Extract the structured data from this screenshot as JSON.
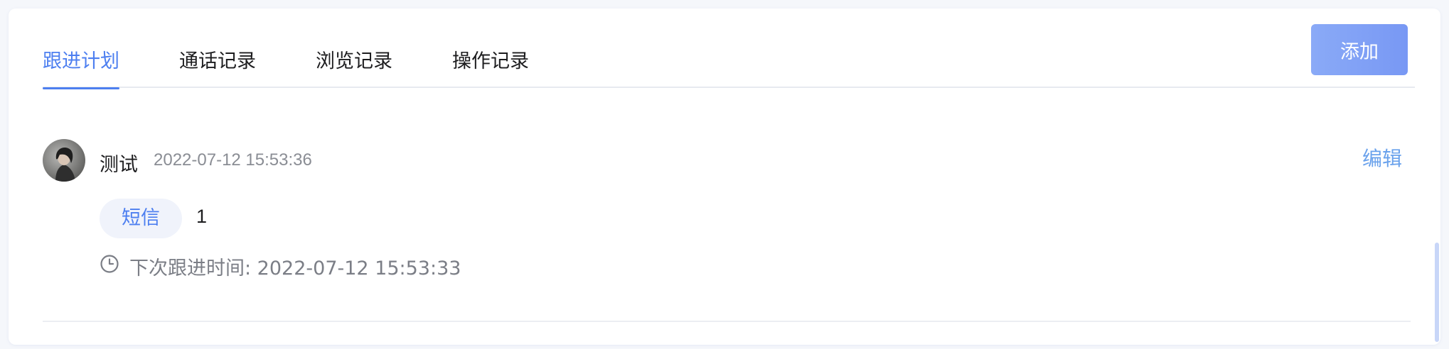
{
  "tabs": [
    {
      "label": "跟进计划",
      "active": true
    },
    {
      "label": "通话记录",
      "active": false
    },
    {
      "label": "浏览记录",
      "active": false
    },
    {
      "label": "操作记录",
      "active": false
    }
  ],
  "toolbar": {
    "add_label": "添加"
  },
  "record": {
    "author": "测试",
    "timestamp": "2022-07-12 15:53:36",
    "edit_label": "编辑",
    "type_label": "短信",
    "content": "1",
    "next_followup": "下次跟进时间: 2022-07-12 15:53:33"
  },
  "colors": {
    "accent": "#4d7ff0",
    "button_gradient_start": "#8aaaf7",
    "button_gradient_end": "#7898f4",
    "link": "#6aa2ec",
    "badge_bg": "#f0f3fb"
  },
  "icons": {
    "avatar": "user-avatar-photo",
    "clock": "clock-icon"
  }
}
